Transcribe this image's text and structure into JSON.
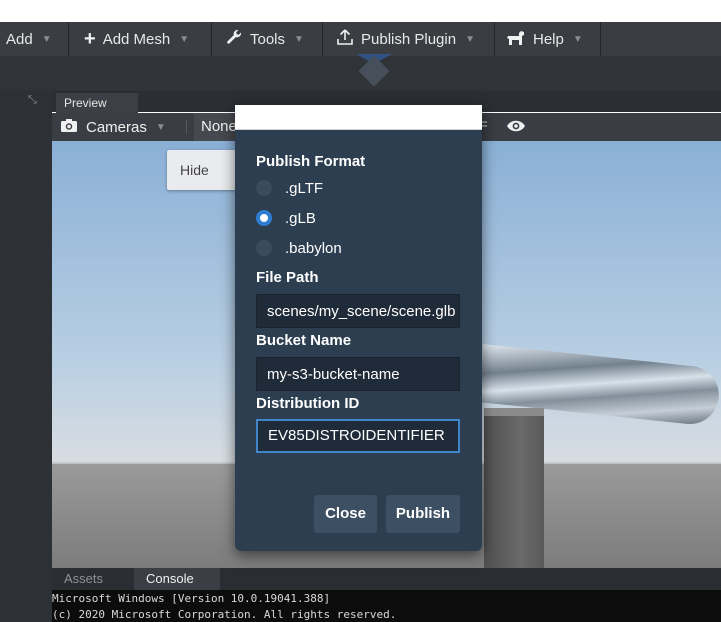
{
  "toolbar": {
    "items": [
      {
        "label": "Add",
        "icon": "none"
      },
      {
        "label": "Add Mesh",
        "icon": "plus-icon"
      },
      {
        "label": "Tools",
        "icon": "wrench-icon"
      },
      {
        "label": "Publish Plugin",
        "icon": "upload-icon"
      },
      {
        "label": "Help",
        "icon": "dog-icon"
      }
    ]
  },
  "preview": {
    "tab_label": "Preview",
    "cameras_label": "Cameras",
    "none_label": "None",
    "tooltip": "Hide Gizmos"
  },
  "modal": {
    "publish_format_label": "Publish Format",
    "formats": [
      {
        "label": ".gLTF",
        "selected": false
      },
      {
        "label": ".gLB",
        "selected": true
      },
      {
        "label": ".babylon",
        "selected": false
      }
    ],
    "file_path_label": "File Path",
    "file_path_value": "scenes/my_scene/scene.glb",
    "bucket_name_label": "Bucket Name",
    "bucket_name_value": "my-s3-bucket-name",
    "distribution_id_label": "Distribution ID",
    "distribution_id_value": "EV85DISTROIDENTIFIER",
    "close_label": "Close",
    "publish_label": "Publish"
  },
  "console": {
    "tabs": [
      "Assets",
      "Console"
    ],
    "lines": [
      "Microsoft Windows [Version 10.0.19041.388]",
      "(c) 2020 Microsoft Corporation. All rights reserved."
    ]
  },
  "colors": {
    "toolbar_bg": "#3a3d42",
    "modal_bg": "#2c3e50",
    "accent": "#2d7fd4"
  }
}
